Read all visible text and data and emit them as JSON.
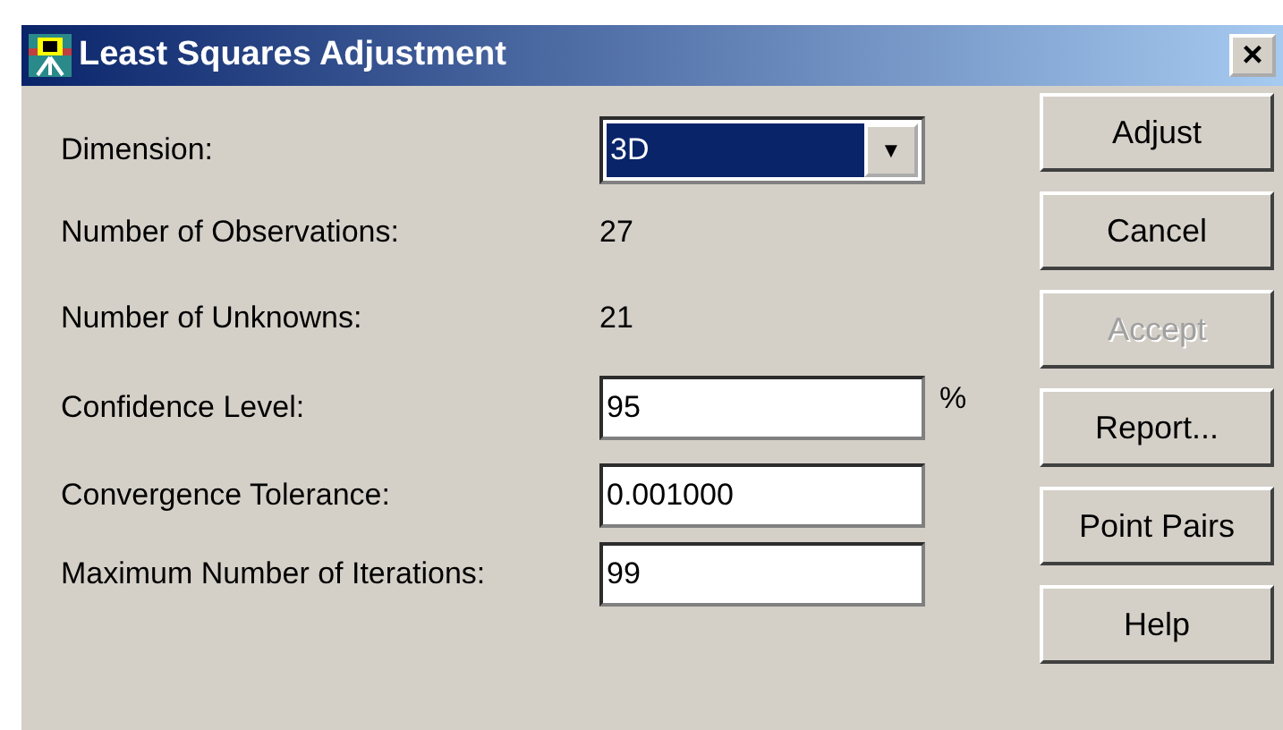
{
  "window": {
    "title": "Least Squares Adjustment",
    "close": "×"
  },
  "fields": [
    {
      "kind": "combo",
      "label": "Dimension:",
      "value": "3D",
      "arrow": "▼"
    },
    {
      "kind": "static",
      "label": "Number of Observations:",
      "value": "27"
    },
    {
      "kind": "static",
      "label": "Number of Unknowns:",
      "value": "21"
    },
    {
      "kind": "input",
      "label": "Confidence Level:",
      "value": "95",
      "unit": "%"
    },
    {
      "kind": "input",
      "label": "Convergence Tolerance:",
      "value": "0.001000"
    },
    {
      "kind": "input",
      "label": "Maximum Number of Iterations:",
      "value": "99"
    }
  ],
  "buttons": [
    {
      "label": "Adjust",
      "disabled": false
    },
    {
      "label": "Cancel",
      "disabled": false
    },
    {
      "label": "Accept",
      "disabled": true
    },
    {
      "label": "Report...",
      "disabled": false
    },
    {
      "label": "Point Pairs",
      "disabled": false
    },
    {
      "label": "Help",
      "disabled": false
    }
  ]
}
